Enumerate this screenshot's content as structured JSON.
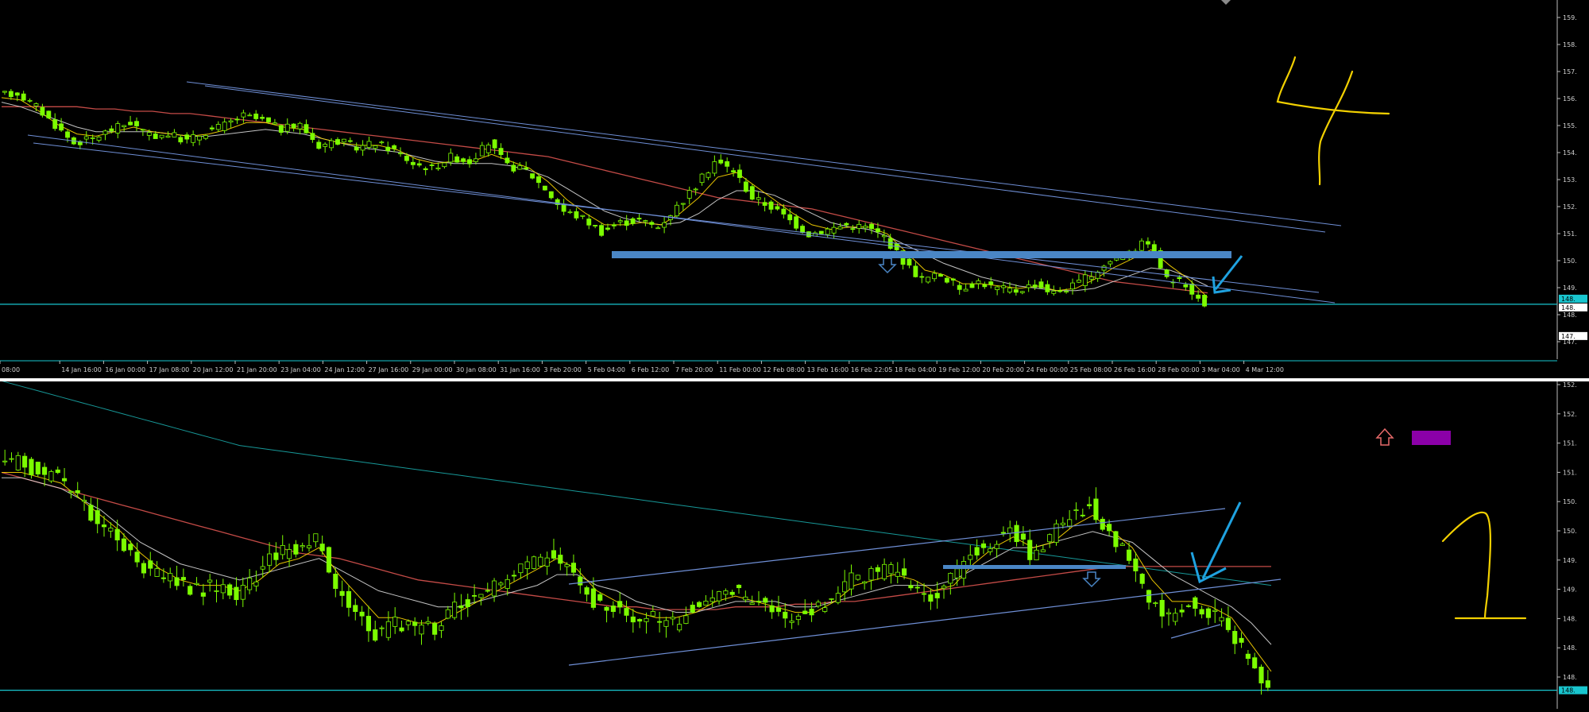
{
  "colors": {
    "background": "#000000",
    "grid": "#2a2a2a",
    "candle": "#7CFC00",
    "wick": "#7CFC00",
    "ma_fast": "#ffd700",
    "ma_mid": "#d8d8d8",
    "ma_slow": "#d9534f",
    "ma_long": "#1aa7a7",
    "trend": "#6f8fd6",
    "zone": "#4a86c5",
    "arrow_blue": "#1fa2e0",
    "annotation": "#f2d000",
    "up_arrow": "#e86a6a",
    "marker": "#8b00a8",
    "price_line": "#19c6cf",
    "axis_text": "#cfcfcf"
  },
  "annotations": {
    "top_number": "4",
    "bottom_number": "1"
  },
  "chart_data": [
    {
      "type": "line",
      "subtype": "candlestick",
      "x_tick_labels": [
        "08:00",
        "14 Jan 16:00",
        "16 Jan 00:00",
        "17 Jan 08:00",
        "20 Jan 12:00",
        "21 Jan 20:00",
        "23 Jan 04:00",
        "24 Jan 12:00",
        "27 Jan 16:00",
        "29 Jan 00:00",
        "30 Jan 08:00",
        "31 Jan 16:00",
        "3 Feb 20:00",
        "5 Feb 04:00",
        "6 Feb 12:00",
        "7 Feb 20:00",
        "11 Feb 00:00",
        "12 Feb 08:00",
        "13 Feb 16:00",
        "16 Feb 22:05",
        "18 Feb 04:00",
        "19 Feb 12:00",
        "20 Feb 20:00",
        "24 Feb 00:00",
        "25 Feb 08:00",
        "26 Feb 16:00",
        "28 Feb 00:00",
        "3 Mar 04:00",
        "4 Mar 12:00"
      ],
      "y_tick_labels": [
        "159.",
        "158.",
        "157.",
        "156.",
        "155.",
        "154.",
        "153.",
        "152.",
        "151.",
        "150.",
        "149.",
        "148.",
        "147."
      ],
      "price_tags": [
        "148.",
        "148.",
        "147."
      ],
      "ylim": [
        147.0,
        159.6
      ],
      "close_path": [
        157.5,
        157.6,
        157.0,
        156.2,
        155.4,
        155.6,
        156.0,
        156.3,
        155.7,
        155.8,
        155.5,
        155.9,
        156.2,
        156.6,
        156.4,
        156.0,
        156.2,
        155.3,
        155.5,
        155.2,
        155.4,
        155.1,
        154.5,
        154.3,
        154.8,
        154.6,
        155.4,
        154.4,
        154.2,
        153.4,
        152.4,
        152.1,
        151.5,
        151.9,
        152.0,
        151.7,
        152.6,
        153.5,
        154.6,
        154.2,
        153.0,
        152.6,
        152.0,
        151.4,
        151.6,
        151.8,
        151.7,
        151.3,
        150.2,
        149.4,
        149.6,
        149.0,
        149.3,
        149.0,
        148.9,
        149.2,
        148.8,
        149.1,
        149.6,
        150.2,
        150.6,
        151.1,
        149.4,
        149.2,
        148.2
      ],
      "ma_fast": [
        157.4,
        157.3,
        156.8,
        156.2,
        155.8,
        155.7,
        155.9,
        156.1,
        155.9,
        155.8,
        155.7,
        155.8,
        156.0,
        156.3,
        156.3,
        156.1,
        156.0,
        155.6,
        155.4,
        155.3,
        155.3,
        155.1,
        154.7,
        154.5,
        154.6,
        154.6,
        154.9,
        154.6,
        154.3,
        153.7,
        152.9,
        152.3,
        151.8,
        151.8,
        151.9,
        151.8,
        152.3,
        153.0,
        153.9,
        154.1,
        153.5,
        152.9,
        152.3,
        151.8,
        151.6,
        151.7,
        151.7,
        151.4,
        150.6,
        149.8,
        149.6,
        149.2,
        149.2,
        149.1,
        149.0,
        149.1,
        148.9,
        149.0,
        149.4,
        149.9,
        150.3,
        150.7,
        150.0,
        149.4,
        148.6
      ],
      "ma_mid": [
        157.2,
        157.0,
        156.7,
        156.4,
        156.1,
        155.9,
        155.9,
        155.9,
        155.9,
        155.8,
        155.7,
        155.7,
        155.8,
        155.9,
        156.0,
        155.9,
        155.8,
        155.6,
        155.4,
        155.2,
        155.1,
        155.0,
        154.8,
        154.6,
        154.5,
        154.5,
        154.5,
        154.4,
        154.2,
        153.9,
        153.4,
        152.9,
        152.4,
        152.1,
        151.9,
        151.8,
        151.9,
        152.3,
        152.9,
        153.3,
        153.3,
        153.1,
        152.7,
        152.3,
        151.9,
        151.7,
        151.6,
        151.3,
        150.9,
        150.5,
        150.1,
        149.8,
        149.5,
        149.3,
        149.1,
        149.0,
        148.9,
        148.9,
        149.0,
        149.3,
        149.6,
        149.9,
        149.8,
        149.5,
        149.1
      ],
      "ma_slow": [
        157.0,
        157.0,
        157.0,
        157.0,
        157.0,
        156.9,
        156.9,
        156.8,
        156.8,
        156.7,
        156.7,
        156.6,
        156.5,
        156.4,
        156.3,
        156.2,
        156.1,
        156.0,
        155.9,
        155.8,
        155.7,
        155.6,
        155.5,
        155.4,
        155.3,
        155.2,
        155.1,
        155.0,
        154.9,
        154.8,
        154.6,
        154.4,
        154.2,
        154.0,
        153.8,
        153.6,
        153.4,
        153.2,
        153.0,
        152.9,
        152.8,
        152.7,
        152.6,
        152.5,
        152.3,
        152.1,
        151.9,
        151.7,
        151.5,
        151.3,
        151.1,
        150.9,
        150.7,
        150.5,
        150.3,
        150.1,
        149.9,
        149.7,
        149.5,
        149.3,
        149.2,
        149.1,
        149.0,
        148.9,
        148.8
      ],
      "levels": {
        "resistance_zone": 151.0,
        "current_price": 148.3
      }
    },
    {
      "type": "line",
      "subtype": "candlestick",
      "y_tick_labels": [
        "152.",
        "152.",
        "151.",
        "151.",
        "150.",
        "150.",
        "149.",
        "149.",
        "148.",
        "148.",
        "148."
      ],
      "price_tags": [
        "148."
      ],
      "ylim": [
        147.4,
        152.6
      ],
      "close_path": [
        151.6,
        151.7,
        151.5,
        151.4,
        151.0,
        150.6,
        150.2,
        149.8,
        149.6,
        149.5,
        149.3,
        149.4,
        149.2,
        149.6,
        150.0,
        150.1,
        150.3,
        149.3,
        148.9,
        148.5,
        148.7,
        148.6,
        148.6,
        149.0,
        149.2,
        149.4,
        149.6,
        149.8,
        150.0,
        149.6,
        149.1,
        149.0,
        148.7,
        148.8,
        148.7,
        149.0,
        149.2,
        149.3,
        149.1,
        148.9,
        148.8,
        148.9,
        149.2,
        149.5,
        149.6,
        149.7,
        149.4,
        149.2,
        149.5,
        150.0,
        150.2,
        150.4,
        150.0,
        150.3,
        150.7,
        150.9,
        150.3,
        149.9,
        149.1,
        148.8,
        149.1,
        148.9,
        148.6,
        148.0,
        147.5
      ],
      "ma_fast": [
        151.5,
        151.5,
        151.4,
        151.3,
        151.0,
        150.7,
        150.4,
        150.0,
        149.7,
        149.5,
        149.4,
        149.4,
        149.3,
        149.5,
        149.8,
        149.9,
        150.1,
        149.6,
        149.2,
        148.8,
        148.8,
        148.7,
        148.7,
        148.9,
        149.1,
        149.3,
        149.5,
        149.7,
        149.9,
        149.7,
        149.3,
        149.1,
        148.9,
        148.8,
        148.8,
        148.9,
        149.1,
        149.2,
        149.1,
        149.0,
        148.9,
        148.9,
        149.1,
        149.4,
        149.5,
        149.6,
        149.5,
        149.3,
        149.4,
        149.8,
        150.1,
        150.3,
        150.1,
        150.2,
        150.5,
        150.7,
        150.4,
        150.1,
        149.5,
        149.1,
        149.1,
        149.0,
        148.8,
        148.3,
        147.8
      ],
      "ma_mid": [
        151.4,
        151.4,
        151.3,
        151.2,
        151.0,
        150.8,
        150.5,
        150.2,
        150.0,
        149.8,
        149.7,
        149.6,
        149.5,
        149.6,
        149.7,
        149.8,
        149.9,
        149.7,
        149.5,
        149.3,
        149.2,
        149.1,
        149.0,
        149.0,
        149.1,
        149.2,
        149.3,
        149.4,
        149.6,
        149.6,
        149.4,
        149.3,
        149.1,
        149.0,
        148.9,
        148.9,
        149.0,
        149.1,
        149.1,
        149.1,
        149.0,
        149.0,
        149.1,
        149.2,
        149.3,
        149.4,
        149.4,
        149.4,
        149.5,
        149.7,
        149.9,
        150.1,
        150.1,
        150.2,
        150.3,
        150.4,
        150.3,
        150.2,
        149.9,
        149.6,
        149.4,
        149.2,
        149.0,
        148.7,
        148.3
      ],
      "ma_slow": [
        151.5,
        151.4,
        151.3,
        151.2,
        151.1,
        151.0,
        150.9,
        150.8,
        150.7,
        150.6,
        150.5,
        150.4,
        150.3,
        150.2,
        150.1,
        150.0,
        149.95,
        149.9,
        149.8,
        149.7,
        149.6,
        149.5,
        149.45,
        149.4,
        149.35,
        149.3,
        149.25,
        149.2,
        149.15,
        149.1,
        149.05,
        149.0,
        149.0,
        148.95,
        148.95,
        148.95,
        148.95,
        149.0,
        149.0,
        149.0,
        149.05,
        149.05,
        149.1,
        149.1,
        149.15,
        149.2,
        149.25,
        149.3,
        149.35,
        149.4,
        149.45,
        149.5,
        149.55,
        149.6,
        149.65,
        149.7,
        149.75,
        149.75,
        149.75,
        149.75,
        149.75,
        149.75,
        149.75,
        149.75,
        149.75
      ],
      "ma_long": [
        153.2,
        153.1,
        153.0,
        152.9,
        152.8,
        152.7,
        152.6,
        152.5,
        152.4,
        152.3,
        152.2,
        152.1,
        152.0,
        151.95,
        151.9,
        151.85,
        151.8,
        151.75,
        151.7,
        151.65,
        151.6,
        151.55,
        151.5,
        151.45,
        151.4,
        151.35,
        151.3,
        151.25,
        151.2,
        151.15,
        151.1,
        151.05,
        151.0,
        150.95,
        150.9,
        150.85,
        150.8,
        150.75,
        150.7,
        150.65,
        150.6,
        150.55,
        150.5,
        150.45,
        150.4,
        150.35,
        150.3,
        150.25,
        150.2,
        150.15,
        150.1,
        150.05,
        150.0,
        149.95,
        149.9,
        149.85,
        149.8,
        149.75,
        149.7,
        149.65,
        149.6,
        149.55,
        149.5,
        149.45,
        149.4
      ],
      "levels": {
        "support_zone": 149.4,
        "current_price": 147.45
      }
    }
  ]
}
